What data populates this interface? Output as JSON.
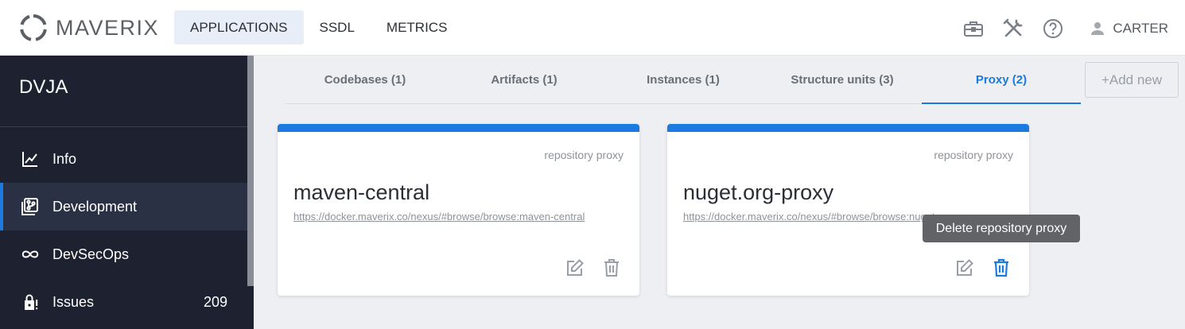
{
  "brand": {
    "name": "MAVERIX"
  },
  "nav": {
    "items": [
      {
        "label": "APPLICATIONS"
      },
      {
        "label": "SSDL"
      },
      {
        "label": "METRICS"
      }
    ]
  },
  "user": {
    "name": "CARTER"
  },
  "sidebar": {
    "app_title": "DVJA",
    "items": [
      {
        "label": "Info",
        "icon": "chart-line-icon"
      },
      {
        "label": "Development",
        "icon": "source-branch-icon"
      },
      {
        "label": "DevSecOps",
        "icon": "infinity-icon"
      },
      {
        "label": "Issues",
        "icon": "lock-alert-icon",
        "count": "209"
      }
    ]
  },
  "tabs": [
    {
      "label": "Codebases (1)"
    },
    {
      "label": "Artifacts (1)"
    },
    {
      "label": "Instances (1)"
    },
    {
      "label": "Structure units (3)"
    },
    {
      "label": "Proxy (2)"
    }
  ],
  "add_new_label": "+Add new",
  "cards": [
    {
      "type": "repository proxy",
      "name": "maven-central",
      "url": "https://docker.maverix.co/nexus/#browse/browse:maven-central"
    },
    {
      "type": "repository proxy",
      "name": "nuget.org-proxy",
      "url": "https://docker.maverix.co/nexus/#browse/browse:nuget.org-proxy"
    }
  ],
  "tooltip": {
    "text": "Delete repository proxy"
  },
  "colors": {
    "accent": "#1a7ae0",
    "sidebar_bg": "#1e2230",
    "sidebar_active": "#2b3144"
  }
}
